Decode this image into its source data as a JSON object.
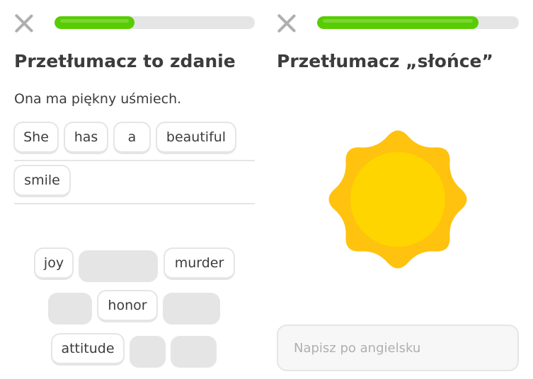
{
  "left": {
    "progress": 0.4,
    "title": "Przetłumacz to zdanie",
    "prompt": "Ona ma piękny uśmiech.",
    "answer_words": [
      "She",
      "has",
      "a",
      "beautiful",
      "smile"
    ],
    "bank_words": {
      "joy": "joy",
      "murder": "murder",
      "honor": "honor",
      "attitude": "attitude"
    }
  },
  "right": {
    "progress": 0.8,
    "title": "Przetłumacz „słońce”",
    "image_icon": "sun-icon",
    "input": {
      "placeholder": "Napisz po angielsku",
      "value": ""
    }
  },
  "colors": {
    "progress_green": "#58cc02",
    "sun_outer": "#ffc20e",
    "sun_inner": "#ffd500",
    "chip_border": "#e5e5e5",
    "text": "#3c3c3c",
    "muted": "#afafaf"
  }
}
